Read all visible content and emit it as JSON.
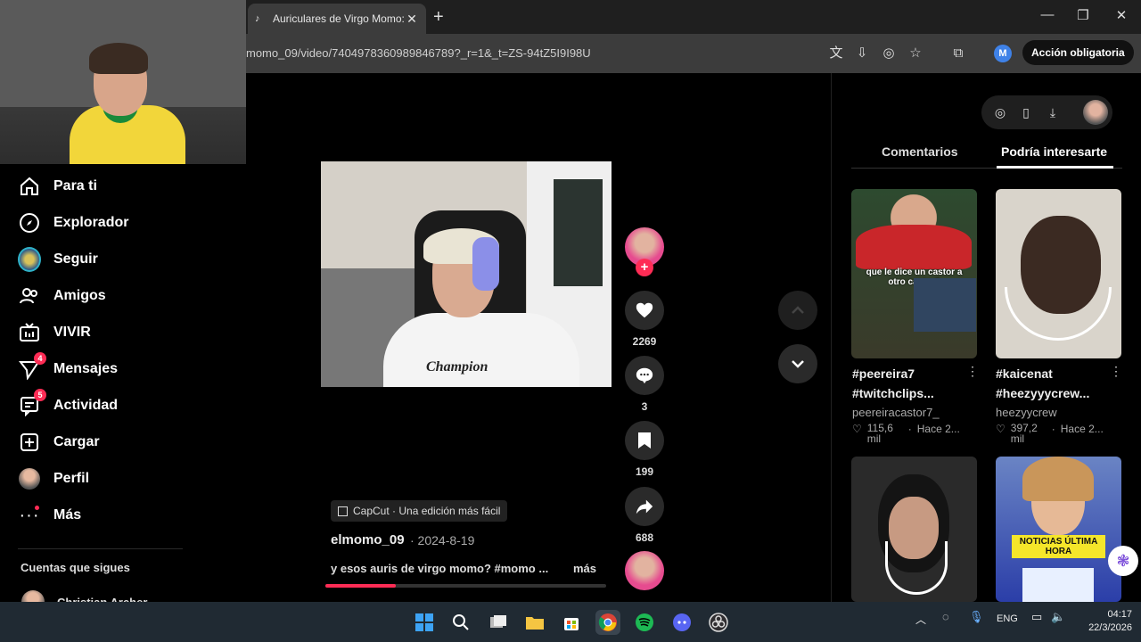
{
  "browser": {
    "tab_title": "Auriculares de Virgo Momo: ¿O",
    "url": "momo_09/video/7404978360989846789?_r=1&_t=ZS-94tZ5I9I98U",
    "profile_initial": "M",
    "action_button": "Acción obligatoria"
  },
  "sidebar": {
    "items": [
      {
        "label": "Para ti",
        "icon": "home-icon"
      },
      {
        "label": "Explorador",
        "icon": "compass-icon"
      },
      {
        "label": "Seguir",
        "icon": "following-avatar-icon"
      },
      {
        "label": "Amigos",
        "icon": "friends-icon"
      },
      {
        "label": "VIVIR",
        "icon": "live-tv-icon"
      },
      {
        "label": "Mensajes",
        "icon": "messages-icon",
        "badge": "4"
      },
      {
        "label": "Actividad",
        "icon": "activity-icon",
        "badge": "5"
      },
      {
        "label": "Cargar",
        "icon": "upload-icon"
      },
      {
        "label": "Perfil",
        "icon": "profile-avatar"
      },
      {
        "label": "Más",
        "icon": "more-dots-icon"
      }
    ],
    "following_heading": "Cuentas que sigues",
    "followed_account": "Christian Archer"
  },
  "video": {
    "brand_text": "Champion",
    "likes": "2269",
    "comments": "3",
    "saves": "199",
    "shares": "688",
    "capcut_label": "CapCut · Una edición más fácil",
    "author": "elmomo_09",
    "date": "· 2024-8-19",
    "caption": "y esos auris de virgo momo? #momo ...",
    "more_label": "más",
    "progress_percent": 25
  },
  "right_panel": {
    "tabs": [
      "Comentarios",
      "Podría interesarte"
    ],
    "active_tab": 1,
    "cards": [
      {
        "tags": [
          "#peereira7",
          "#twitchclips..."
        ],
        "user": "peereiracastor7_",
        "likes": "115,6 mil",
        "time": "Hace 2...",
        "overlay": "que le dice un castor a otro castor?"
      },
      {
        "tags": [
          "#kaicenat",
          "#heezyyycrew..."
        ],
        "user": "heezyycrew",
        "likes": "397,2 mil",
        "time": "Hace 2...",
        "overlay": ""
      },
      {
        "tags": [],
        "user": "",
        "likes": "",
        "time": "",
        "overlay": ""
      },
      {
        "tags": [],
        "user": "",
        "likes": "",
        "time": "",
        "overlay": "NOTICIAS ÚLTIMA HORA"
      }
    ]
  },
  "taskbar": {
    "lang": "ENG",
    "time": "04:17",
    "date": "22/3/2026"
  },
  "colors": {
    "accent": "#fe2c55",
    "background": "#000000",
    "taskbar": "#202a33"
  }
}
